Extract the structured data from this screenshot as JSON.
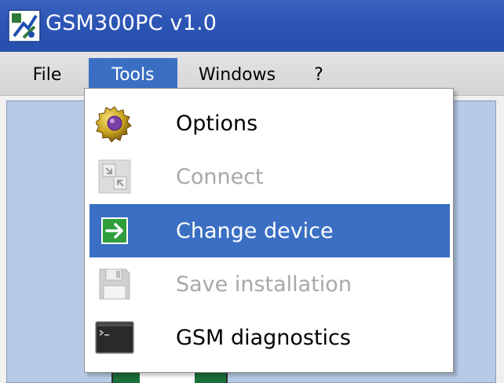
{
  "window": {
    "title": "GSM300PC v1.0"
  },
  "menubar": {
    "file": "File",
    "tools": "Tools",
    "windows": "Windows",
    "help": "?"
  },
  "tools_menu": {
    "items": [
      {
        "label": "Options",
        "icon": "gear-icon",
        "enabled": true
      },
      {
        "label": "Connect",
        "icon": "connect-icon",
        "enabled": false
      },
      {
        "label": "Change device",
        "icon": "arrow-right-icon",
        "enabled": true,
        "highlighted": true
      },
      {
        "label": "Save installation",
        "icon": "floppy-disk-icon",
        "enabled": false
      },
      {
        "label": "GSM diagnostics",
        "icon": "terminal-icon",
        "enabled": true
      }
    ]
  },
  "colors": {
    "titlebar": "#2c54b4",
    "menu_highlight": "#3b6fc3",
    "disabled_text": "#a8a8a8",
    "mdi_background": "#b7cbe6"
  }
}
